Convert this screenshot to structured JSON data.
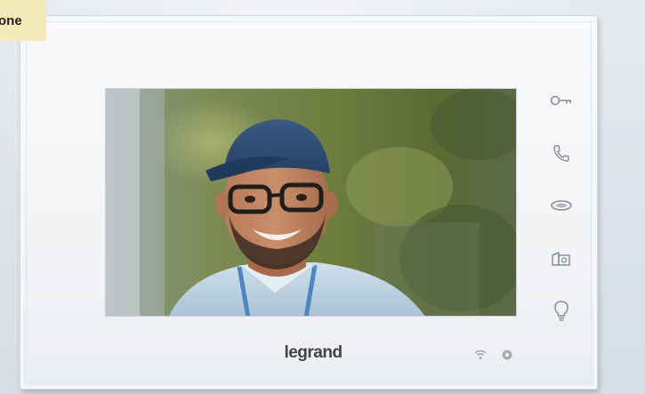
{
  "tag": {
    "label": "one"
  },
  "device": {
    "brand": "legrand",
    "buttons": [
      {
        "name": "key-icon"
      },
      {
        "name": "phone-handset-icon"
      },
      {
        "name": "intercom-icon"
      },
      {
        "name": "camera-switch-icon"
      },
      {
        "name": "light-bulb-icon"
      }
    ],
    "status_icons": [
      {
        "name": "wifi-icon"
      },
      {
        "name": "settings-icon"
      }
    ]
  },
  "colors": {
    "device_body": "#f4f6f8",
    "icon_gray": "#8a9097",
    "brand_text": "#404448",
    "tag_bg": "#f4e9b8"
  }
}
